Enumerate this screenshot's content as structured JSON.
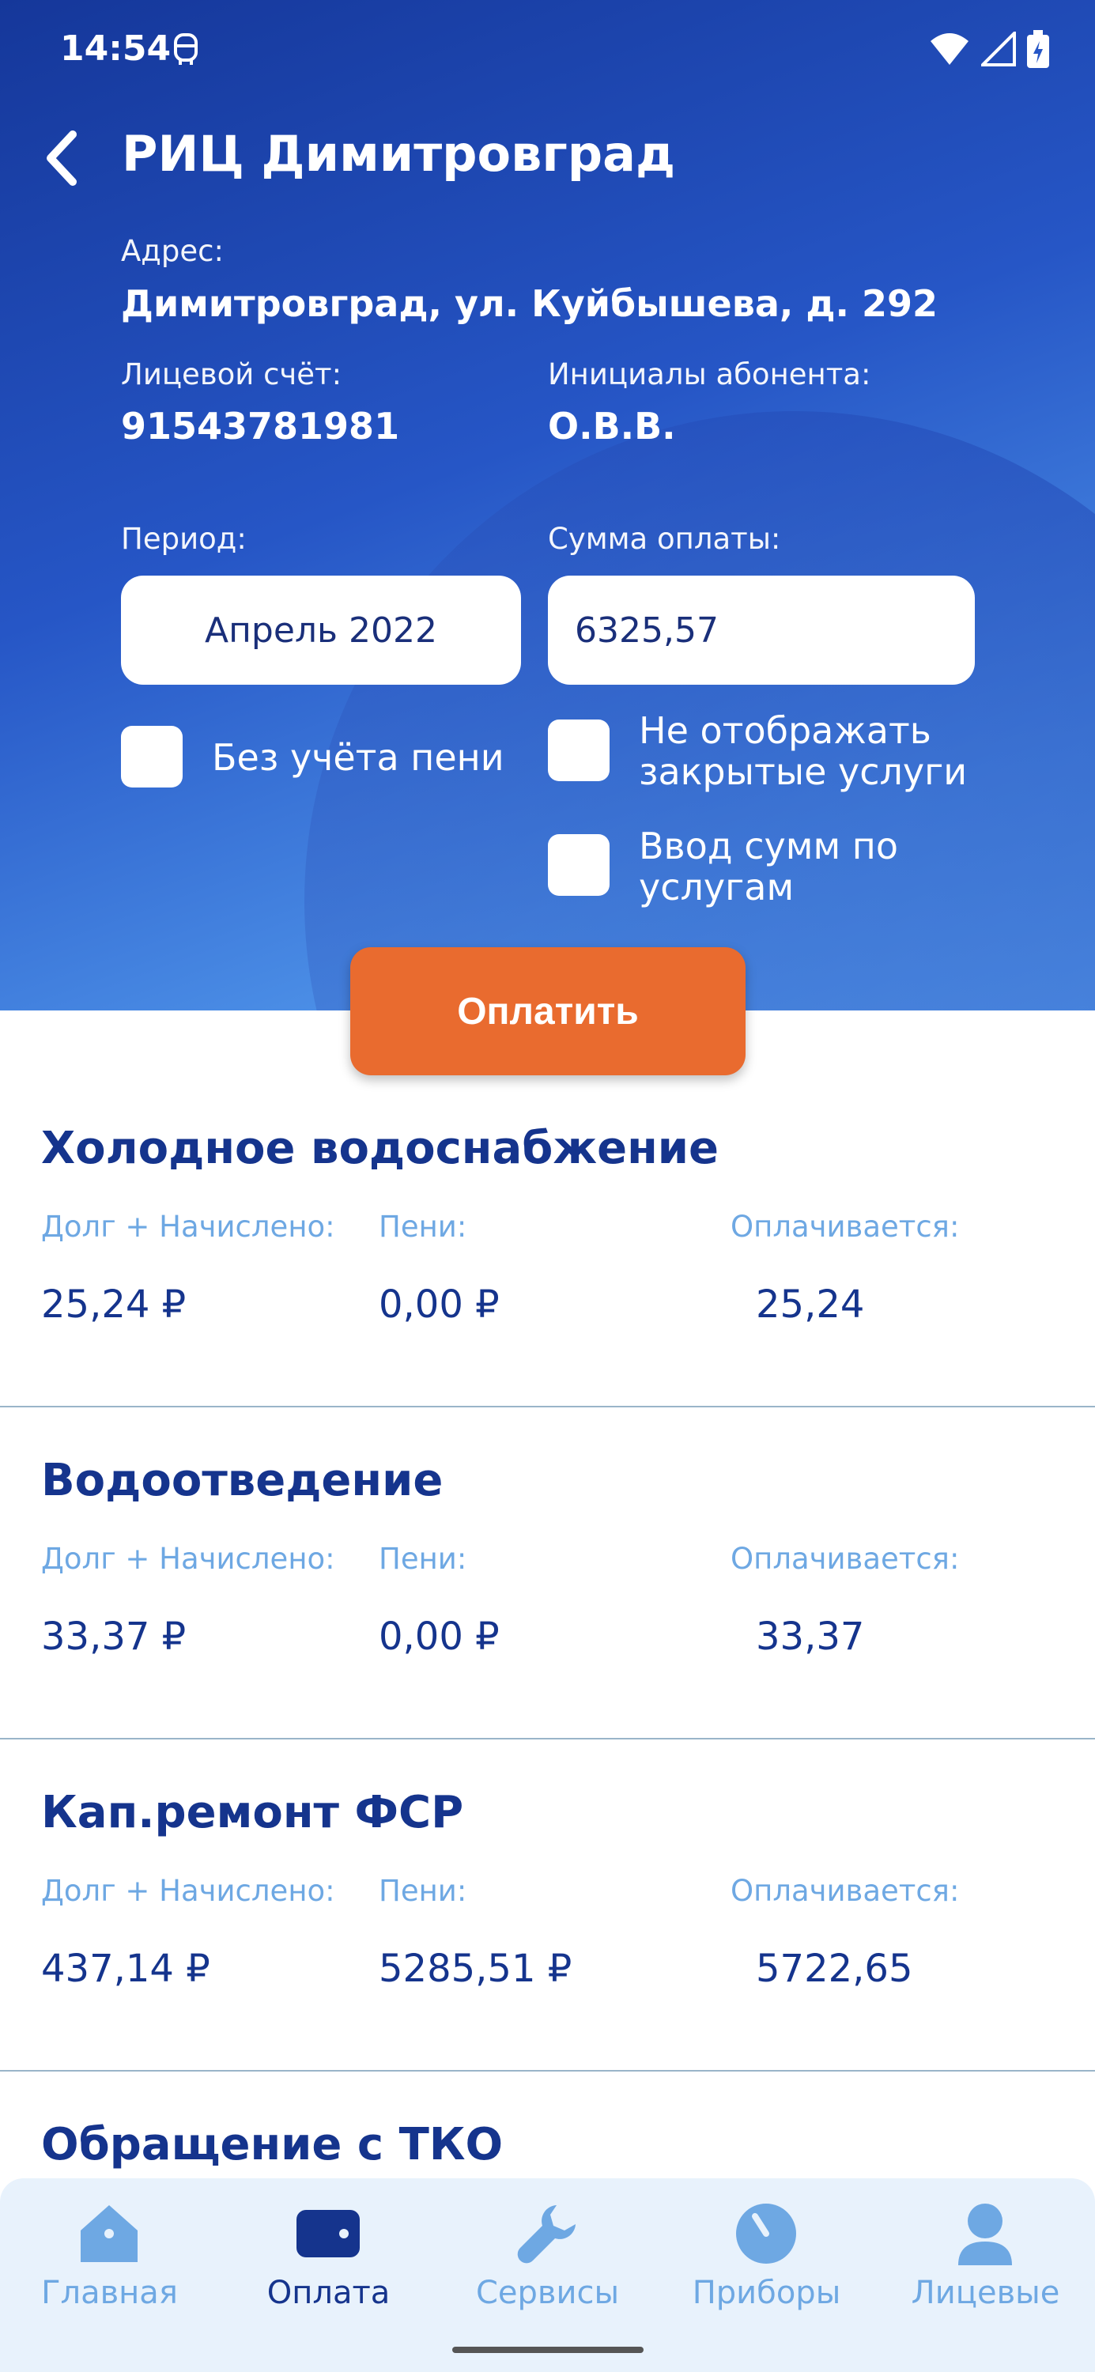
{
  "status_bar": {
    "time": "14:54"
  },
  "header": {
    "title": "РИЦ Димитровград",
    "address_label": "Адрес:",
    "address": "Димитровград, ул. Куйбышева, д. 292",
    "account_label": "Лицевой счёт:",
    "account": "91543781981",
    "initials_label": "Инициалы абонента:",
    "initials": "О.В.В.",
    "period_label": "Период:",
    "period": "Апрель 2022",
    "sum_label": "Сумма оплаты:",
    "sum": "6325,57",
    "checkbox_no_penalty": "Без учёта пени",
    "checkbox_hide_closed_1": "Не отображать",
    "checkbox_hide_closed_2": "закрытые услуги",
    "checkbox_by_service_1": "Ввод сумм по",
    "checkbox_by_service_2": "услугам",
    "pay_button": "Оплатить"
  },
  "columns": {
    "debt": "Долг + Начислено:",
    "penalty": "Пени:",
    "paying": "Оплачивается:"
  },
  "services": [
    {
      "name": "Холодное водоснабжение",
      "debt": "25,24 ₽",
      "penalty": "0,00 ₽",
      "paying": "25,24"
    },
    {
      "name": "Водоотведение",
      "debt": "33,37 ₽",
      "penalty": "0,00 ₽",
      "paying": "33,37"
    },
    {
      "name": "Кап.ремонт ФСР",
      "debt": "437,14 ₽",
      "penalty": "5285,51 ₽",
      "paying": "5722,65"
    },
    {
      "name": "Обращение с ТКО"
    }
  ],
  "bottom_nav": [
    {
      "label": "Главная",
      "icon": "home-icon"
    },
    {
      "label": "Оплата",
      "icon": "wallet-icon"
    },
    {
      "label": "Сервисы",
      "icon": "wrench-icon"
    },
    {
      "label": "Приборы",
      "icon": "meter-icon"
    },
    {
      "label": "Лицевые",
      "icon": "person-icon"
    }
  ],
  "colors": {
    "accent": "#e96b2f",
    "primary": "#15348d",
    "muted": "#6ea8e3"
  }
}
